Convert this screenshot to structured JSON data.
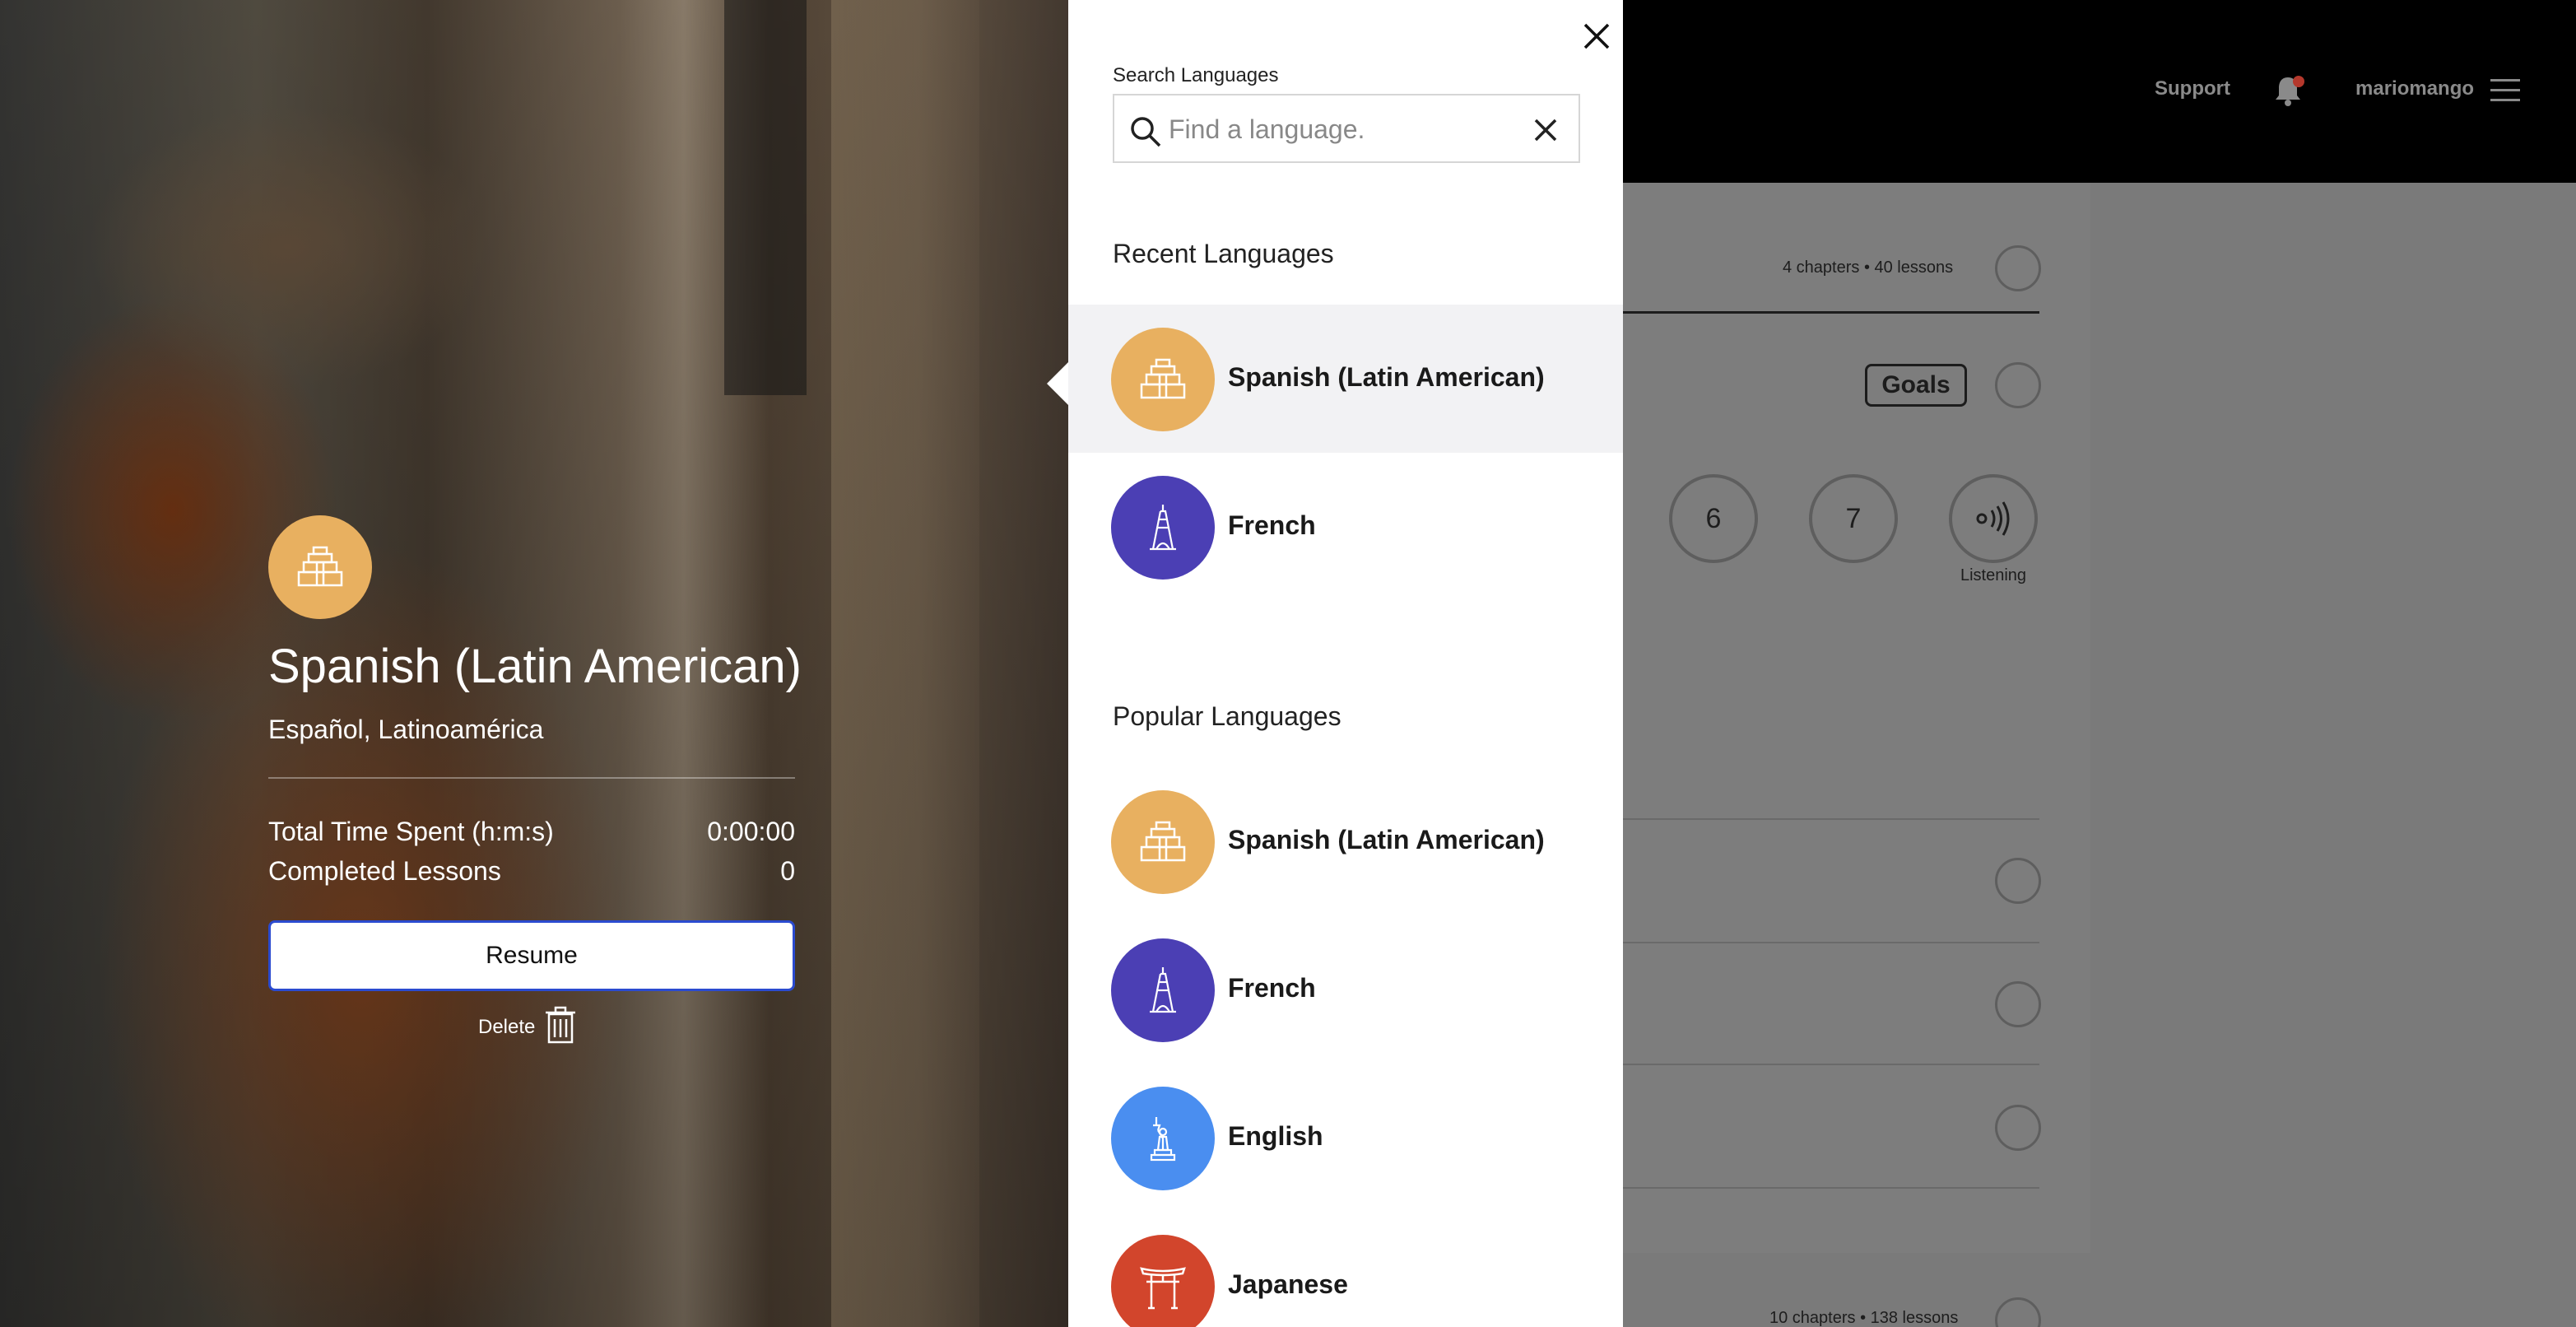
{
  "colors": {
    "spanish": "#e8b060",
    "french": "#4b3fb4",
    "english": "#4a8ef0",
    "japanese": "#d2452c",
    "resume_border": "#2b4bd0"
  },
  "topbar": {
    "support": "Support",
    "username": "mariomango"
  },
  "course": {
    "meta_top": "4 chapters • 40 lessons",
    "goals": "Goals",
    "lesson_numbers": [
      "6",
      "7"
    ],
    "listening_label": "Listening",
    "meta_bottom": "10 chapters • 138 lessons"
  },
  "hero": {
    "title": "Spanish (Latin American)",
    "native_name": "Español, Latinoamérica",
    "stats": [
      {
        "label": "Total Time Spent (h:m:s)",
        "value": "0:00:00"
      },
      {
        "label": "Completed Lessons",
        "value": "0"
      }
    ],
    "resume": "Resume",
    "delete": "Delete"
  },
  "drawer": {
    "search_label": "Search Languages",
    "search_placeholder": "Find a language.",
    "recent_title": "Recent Languages",
    "recent": [
      {
        "name": "Spanish (Latin American)",
        "icon": "pyramid-icon",
        "selected": true
      },
      {
        "name": "French",
        "icon": "eiffel-tower-icon",
        "selected": false
      }
    ],
    "popular_title": "Popular Languages",
    "popular": [
      {
        "name": "Spanish (Latin American)",
        "icon": "pyramid-icon"
      },
      {
        "name": "French",
        "icon": "eiffel-tower-icon"
      },
      {
        "name": "English",
        "icon": "statue-of-liberty-icon"
      },
      {
        "name": "Japanese",
        "icon": "torii-gate-icon"
      }
    ]
  }
}
